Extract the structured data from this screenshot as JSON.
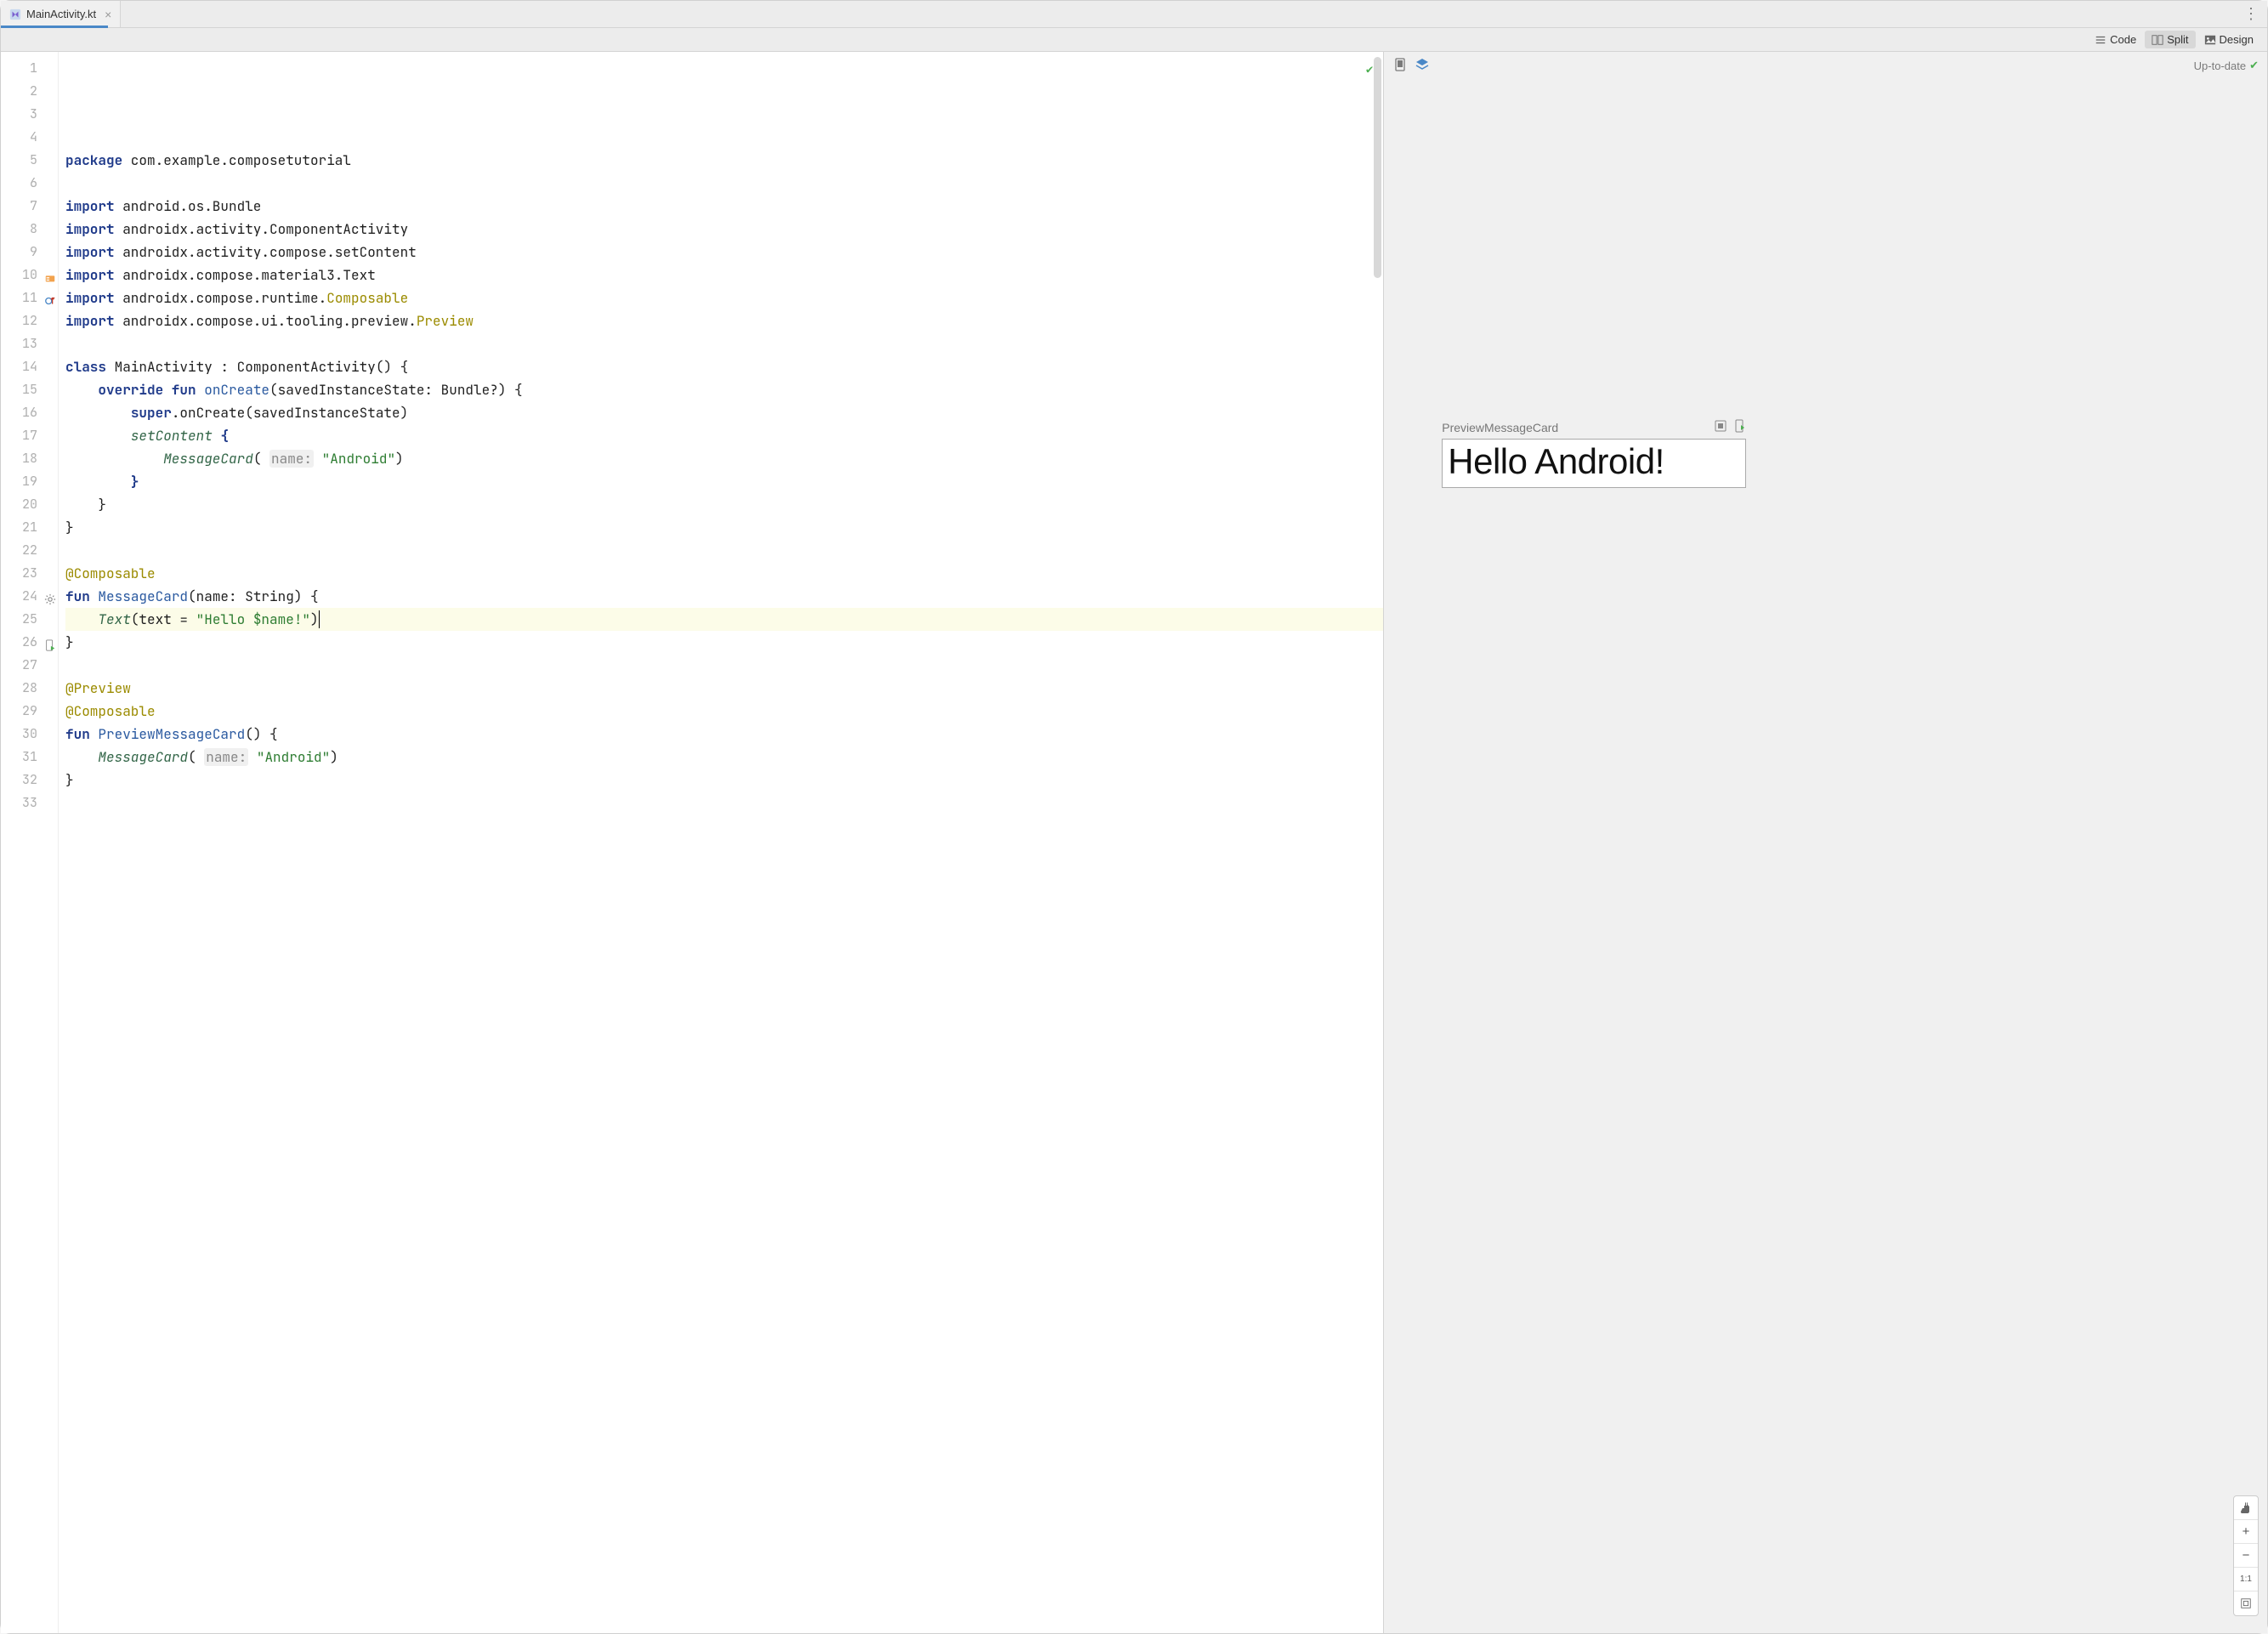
{
  "tab": {
    "filename": "MainActivity.kt"
  },
  "viewModes": {
    "code": "Code",
    "split": "Split",
    "design": "Design"
  },
  "preview": {
    "status": "Up-to-date",
    "label": "PreviewMessageCard",
    "rendered_text": "Hello Android!"
  },
  "zoom": {
    "oneToOne": "1:1"
  },
  "code": {
    "lines": [
      {
        "n": 1,
        "html": "<span class='kw'>package</span> com.example.composetutorial"
      },
      {
        "n": 2,
        "html": ""
      },
      {
        "n": 3,
        "html": "<span class='kw'>import</span> android.os.Bundle"
      },
      {
        "n": 4,
        "html": "<span class='kw'>import</span> androidx.activity.ComponentActivity"
      },
      {
        "n": 5,
        "html": "<span class='kw'>import</span> androidx.activity.compose.setContent"
      },
      {
        "n": 6,
        "html": "<span class='kw'>import</span> androidx.compose.material3.Text"
      },
      {
        "n": 7,
        "html": "<span class='kw'>import</span> androidx.compose.runtime.<span class='annot'>Composable</span>"
      },
      {
        "n": 8,
        "html": "<span class='kw'>import</span> androidx.compose.ui.tooling.preview.<span class='annot'>Preview</span>"
      },
      {
        "n": 9,
        "html": ""
      },
      {
        "n": 10,
        "html": "<span class='kw'>class</span> MainActivity : ComponentActivity() {",
        "icon": "class"
      },
      {
        "n": 11,
        "html": "    <span class='kw'>override fun</span> <span class='fn-def'>onCreate</span>(savedInstanceState: Bundle?) {",
        "icon": "override"
      },
      {
        "n": 12,
        "html": "        <span class='kw'>super</span>.onCreate(savedInstanceState)"
      },
      {
        "n": 13,
        "html": "        <span class='fn-call'>setContent</span> <span class='kw'>{</span>"
      },
      {
        "n": 14,
        "html": "            <span class='fn-call'>MessageCard</span>( <span class='param-hint'>name:</span> <span class='str'>\"Android\"</span>)"
      },
      {
        "n": 15,
        "html": "        <span class='kw'>}</span>"
      },
      {
        "n": 16,
        "html": "    }"
      },
      {
        "n": 17,
        "html": "}"
      },
      {
        "n": 18,
        "html": ""
      },
      {
        "n": 19,
        "html": "<span class='annot'>@Composable</span>"
      },
      {
        "n": 20,
        "html": "<span class='kw'>fun</span> <span class='fn-def'>MessageCard</span>(name: String) {"
      },
      {
        "n": 21,
        "html": "    <span class='fn-call'>Text</span>(text = <span class='str'>\"Hello $name!\"</span>)<span style='border-left:1px solid #000;'></span>",
        "active": true
      },
      {
        "n": 22,
        "html": "}"
      },
      {
        "n": 23,
        "html": ""
      },
      {
        "n": 24,
        "html": "<span class='annot'>@Preview</span>",
        "icon": "gear"
      },
      {
        "n": 25,
        "html": "<span class='annot'>@Composable</span>"
      },
      {
        "n": 26,
        "html": "<span class='kw'>fun</span> <span class='fn-def'>PreviewMessageCard</span>() {",
        "icon": "run"
      },
      {
        "n": 27,
        "html": "    <span class='fn-call'>MessageCard</span>( <span class='param-hint'>name:</span> <span class='str'>\"Android\"</span>)"
      },
      {
        "n": 28,
        "html": "}"
      },
      {
        "n": 29,
        "html": ""
      },
      {
        "n": 30,
        "html": ""
      },
      {
        "n": 31,
        "html": ""
      },
      {
        "n": 32,
        "html": ""
      },
      {
        "n": 33,
        "html": ""
      }
    ]
  }
}
